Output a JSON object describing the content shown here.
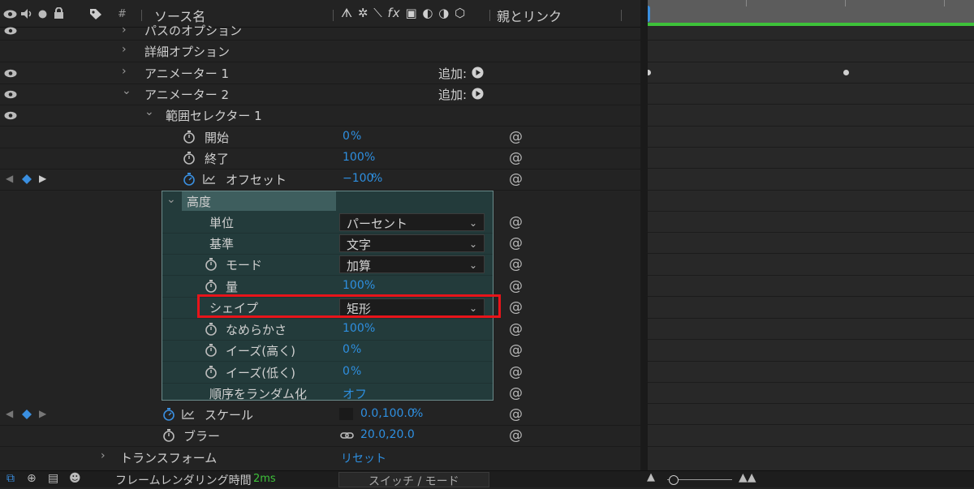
{
  "header": {
    "source_name": "ソース名",
    "parent_link": "親とリンク",
    "hash": "#"
  },
  "rows": {
    "path_options": "パスのオプション",
    "detail_options": "詳細オプション",
    "animator1": "アニメーター 1",
    "animator2": "アニメーター 2",
    "add_label": "追加:",
    "range_selector": "範囲セレクター 1",
    "start": {
      "label": "開始",
      "value": "0",
      "unit": "%"
    },
    "end": {
      "label": "終了",
      "value": "100",
      "unit": "%"
    },
    "offset": {
      "label": "オフセット",
      "value": "−100",
      "unit": "%"
    }
  },
  "advanced": {
    "title": "高度",
    "unit": {
      "label": "単位",
      "value": "パーセント"
    },
    "based_on": {
      "label": "基準",
      "value": "文字"
    },
    "mode": {
      "label": "モード",
      "value": "加算"
    },
    "amount": {
      "label": "量",
      "value": "100",
      "unit": "%"
    },
    "shape": {
      "label": "シェイプ",
      "value": "矩形"
    },
    "smoothness": {
      "label": "なめらかさ",
      "value": "100",
      "unit": "%"
    },
    "ease_high": {
      "label": "イーズ(高く)",
      "value": "0",
      "unit": "%"
    },
    "ease_low": {
      "label": "イーズ(低く)",
      "value": "0",
      "unit": "%"
    },
    "randomize": {
      "label": "順序をランダム化",
      "value": "オフ"
    }
  },
  "scale": {
    "label": "スケール",
    "value": "0.0,100.0",
    "unit": "%"
  },
  "blur": {
    "label": "ブラー",
    "value": "20.0,20.0"
  },
  "transform": {
    "label": "トランスフォーム",
    "reset": "リセット"
  },
  "footer": {
    "render_label": "フレームレンダリング時間",
    "render_value": "2ms",
    "switch_mode": "スイッチ / モード"
  },
  "colors": {
    "highlight": "#e8141a",
    "value_blue": "#2e8fe0",
    "work_area": "#3ec23a",
    "keyframe": "#3a8fe0"
  },
  "icons": [
    "eye-icon",
    "audio-icon",
    "solo-icon",
    "lock-icon",
    "label-icon",
    "stopwatch-icon",
    "graph-icon",
    "spiral-icon",
    "chevron-down-icon",
    "chevron-right-icon",
    "play-circle-icon",
    "link-icon",
    "keyframe-diamond-icon"
  ]
}
